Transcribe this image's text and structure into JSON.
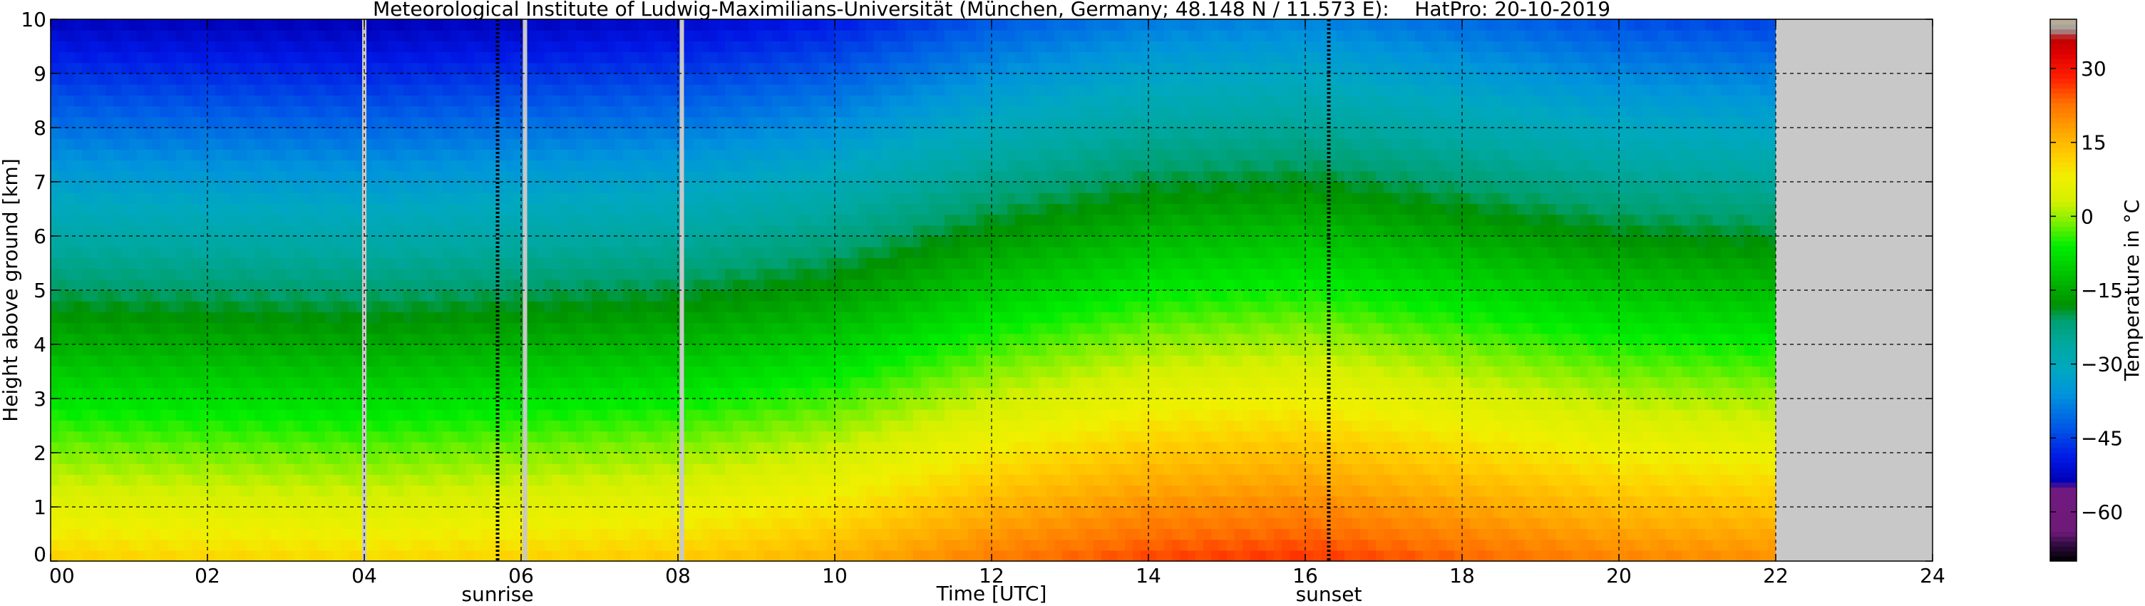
{
  "chart_data": {
    "type": "heatmap",
    "title": "Meteorological Institute of Ludwig-Maximilians-Universität (München, Germany; 48.148 N / 11.573 E):    HatPro: 20-10-2019",
    "xlabel": "Time [UTC]",
    "ylabel": "Height above ground [km]",
    "xlim": [
      0,
      24
    ],
    "ylim": [
      0,
      10
    ],
    "x_ticks": [
      0,
      2,
      4,
      6,
      8,
      10,
      12,
      14,
      16,
      18,
      20,
      22,
      24
    ],
    "x_tick_labels": [
      "00",
      "02",
      "04",
      "06",
      "08",
      "10",
      "12",
      "14",
      "16",
      "18",
      "20",
      "22",
      "24"
    ],
    "y_ticks": [
      0,
      1,
      2,
      3,
      4,
      5,
      6,
      7,
      8,
      9,
      10
    ],
    "y_tick_labels": [
      "0",
      "1",
      "2",
      "3",
      "4",
      "5",
      "6",
      "7",
      "8",
      "9",
      "10"
    ],
    "grid": true,
    "data_end_hour": 22.0,
    "missing_data_color": "#c8c8c8",
    "gaps_hours": [
      4.0,
      6.05,
      8.05
    ],
    "sunrise_hour": 5.7,
    "sunset_hour": 16.3,
    "annotations": [
      {
        "label": "sunrise",
        "x": 5.7
      },
      {
        "label": "sunset",
        "x": 16.3
      }
    ],
    "surface_temperature_by_hour": [
      {
        "x": 0,
        "t": 12
      },
      {
        "x": 4,
        "t": 11
      },
      {
        "x": 6,
        "t": 12
      },
      {
        "x": 8,
        "t": 13
      },
      {
        "x": 10,
        "t": 16
      },
      {
        "x": 12,
        "t": 22
      },
      {
        "x": 14,
        "t": 26
      },
      {
        "x": 16,
        "t": 27
      },
      {
        "x": 18,
        "t": 24
      },
      {
        "x": 20,
        "t": 21
      },
      {
        "x": 22,
        "t": 20
      }
    ],
    "lapse_rate_k_per_km": -6.5,
    "colorbar": {
      "label": "Temperature in °C",
      "range": [
        -70,
        40
      ],
      "ticks": [
        30,
        15,
        0,
        -15,
        -30,
        -45,
        -60
      ],
      "tick_labels": [
        "30",
        "15",
        "0",
        "−15",
        "−30",
        "−45",
        "−60"
      ],
      "colors": [
        {
          "t": -70,
          "c": "#000000"
        },
        {
          "t": -67,
          "c": "#2a0a3a"
        },
        {
          "t": -64,
          "c": "#6e1a78"
        },
        {
          "t": -55,
          "c": "#701a80"
        },
        {
          "t": -54,
          "c": "#0000b4"
        },
        {
          "t": -49,
          "c": "#0018e6"
        },
        {
          "t": -42,
          "c": "#0060e6"
        },
        {
          "t": -36,
          "c": "#0094dc"
        },
        {
          "t": -31,
          "c": "#00a8c0"
        },
        {
          "t": -26,
          "c": "#00a8a0"
        },
        {
          "t": -21,
          "c": "#00a070"
        },
        {
          "t": -18,
          "c": "#009000"
        },
        {
          "t": -12,
          "c": "#00c000"
        },
        {
          "t": -6,
          "c": "#00ee00"
        },
        {
          "t": -1,
          "c": "#80f000"
        },
        {
          "t": 3,
          "c": "#d4f000"
        },
        {
          "t": 8,
          "c": "#f0f000"
        },
        {
          "t": 12,
          "c": "#ffd000"
        },
        {
          "t": 17,
          "c": "#ffa800"
        },
        {
          "t": 23,
          "c": "#ff7000"
        },
        {
          "t": 28,
          "c": "#ff2000"
        },
        {
          "t": 33,
          "c": "#e00000"
        },
        {
          "t": 36,
          "c": "#c00000"
        },
        {
          "t": 38,
          "c": "#a0a0a0"
        },
        {
          "t": 40,
          "c": "#c0b090"
        }
      ]
    }
  }
}
